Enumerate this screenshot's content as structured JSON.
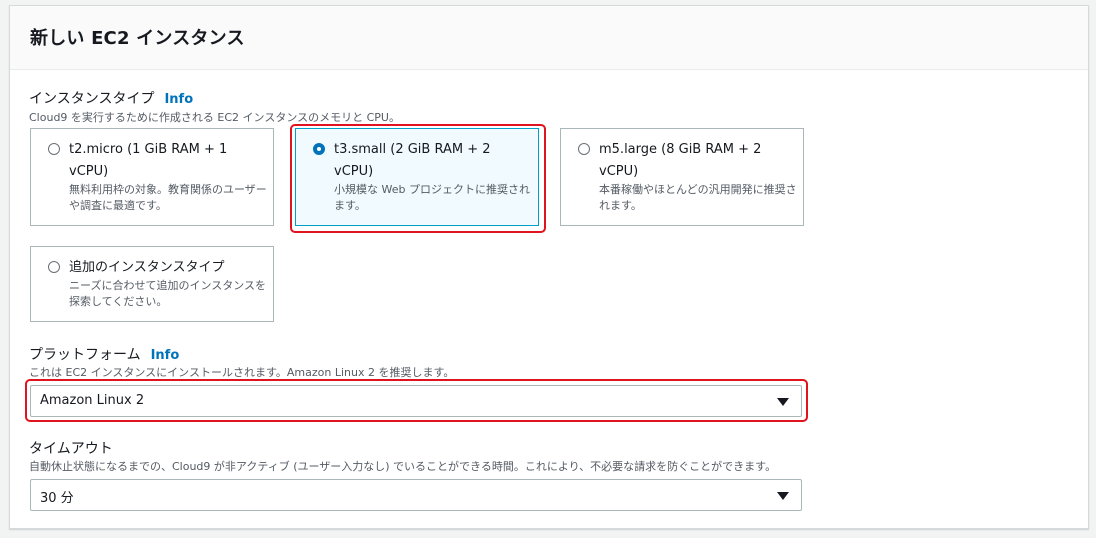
{
  "panel": {
    "title": "新しい EC2 インスタンス"
  },
  "instance_type": {
    "label": "インスタンスタイプ",
    "info": "Info",
    "description": "Cloud9 を実行するために作成される EC2 インスタンスのメモリと CPU。",
    "options": [
      {
        "title": "t2.micro (1 GiB RAM + 1 vCPU)",
        "desc": "無料利用枠の対象。教育関係のユーザーや調査に最適です。",
        "selected": false
      },
      {
        "title": "t3.small (2 GiB RAM + 2 vCPU)",
        "desc": "小規模な Web プロジェクトに推奨されます。",
        "selected": true
      },
      {
        "title": "m5.large (8 GiB RAM + 2 vCPU)",
        "desc": "本番稼働やほとんどの汎用開発に推奨されます。",
        "selected": false
      },
      {
        "title": "追加のインスタンスタイプ",
        "desc": "ニーズに合わせて追加のインスタンスを探索してください。",
        "selected": false
      }
    ]
  },
  "platform": {
    "label": "プラットフォーム",
    "info": "Info",
    "description": "これは EC2 インスタンスにインストールされます。Amazon Linux 2 を推奨します。",
    "value": "Amazon Linux 2"
  },
  "timeout": {
    "label": "タイムアウト",
    "description": "自動休止状態になるまでの、Cloud9 が非アクティブ (ユーザー入力なし) でいることができる時間。これにより、不必要な請求を防ぐことができます。",
    "value": "30 分"
  },
  "colors": {
    "accent": "#0073bb",
    "highlight": "#e0141e",
    "selected_bg": "#f1faff"
  }
}
